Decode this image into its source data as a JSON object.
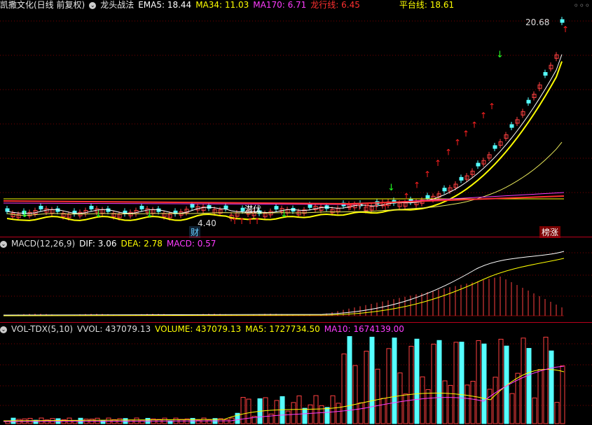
{
  "main": {
    "title": "凯撒文化(日线 前复权)",
    "indicator_name": "龙头战法",
    "ema5": "EMA5: 18.44",
    "ma34": "MA34: 11.03",
    "ma170": "MA170: 6.71",
    "long_line": "龙行线: 6.45",
    "platform": "平台线: 18.61",
    "high_label": "20.68",
    "low_label": "4.40",
    "cai_label": "财",
    "qianfu_label": "潜伏",
    "bangzhang_label": "榜涨",
    "colors": {
      "ema5": "#ffffff",
      "ma34": "#ffff00",
      "ma170": "#ff3cff",
      "long_line": "#ff3030",
      "platform": "#ffff00"
    }
  },
  "macd": {
    "name": "MACD(12,26,9)",
    "dif": "DIF: 3.06",
    "dea": "DEA: 2.78",
    "macd": "MACD: 0.57"
  },
  "vol": {
    "name": "VOL-TDX(5,10)",
    "vvol": "VVOL: 437079.13",
    "volume": "VOLUME: 437079.13",
    "ma5": "MA5: 1727734.50",
    "ma10": "MA10: 1674139.00"
  }
}
